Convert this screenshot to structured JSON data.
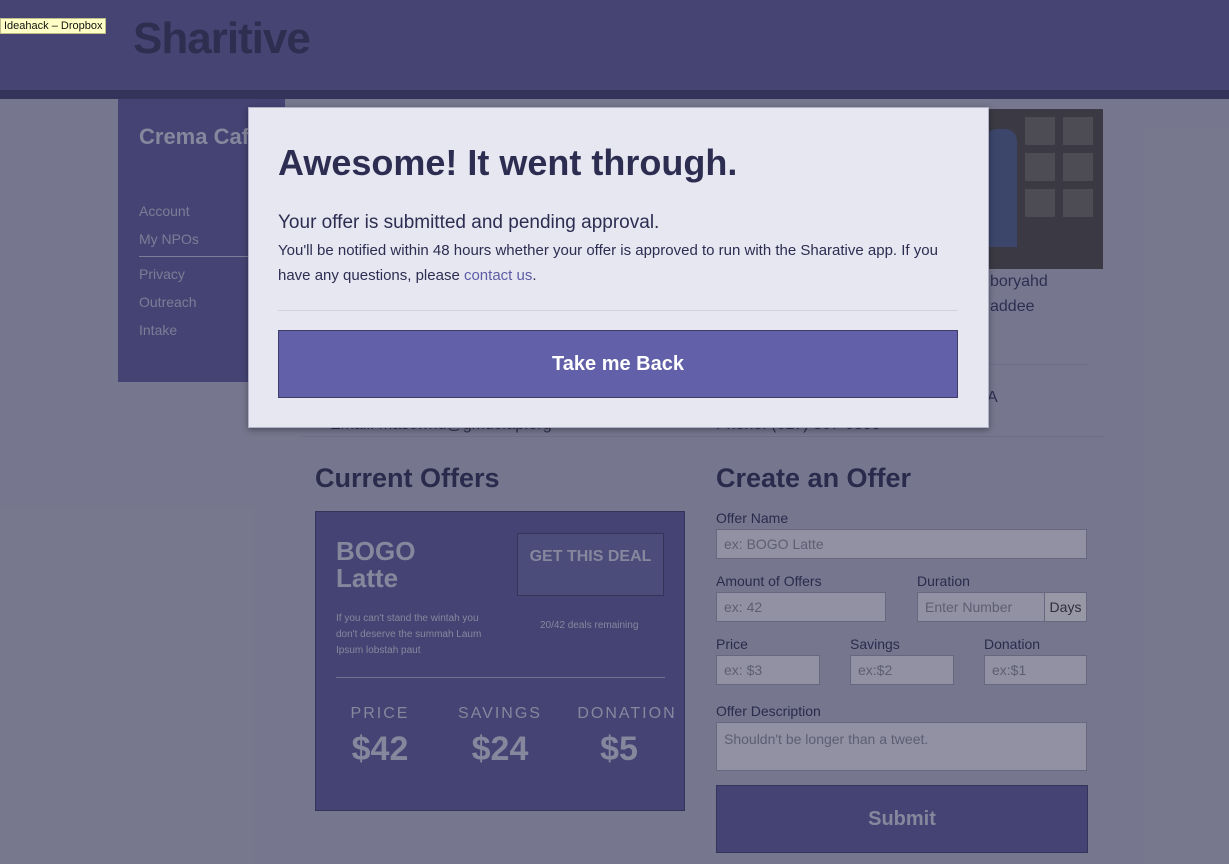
{
  "tooltip": "Ideahack – Dropbox",
  "header": {
    "brand": "Sharitive"
  },
  "sidebar": {
    "business_name": "Crema Cafe",
    "items": [
      "Account",
      "My NPOs",
      "Privacy",
      "Outreach",
      "Intake"
    ]
  },
  "profile_fragments": {
    "name_1": "boryahd",
    "name_2": "addee",
    "location_end": "A",
    "email_fragment": "Email: mascwnd@gmuc.ap.org",
    "phone_fragment": "Phone: (617) 367-0300"
  },
  "current_offers": {
    "title": "Current Offers",
    "offer": {
      "name": "BOGO Latte",
      "cta": "GET THIS DEAL",
      "description": "If you can't stand the wintah you don't deserve the summah Laum Ipsum lobstah paut",
      "remaining": "20/42 deals remaining",
      "stats": [
        {
          "label": "PRICE",
          "value": "$42"
        },
        {
          "label": "SAVINGS",
          "value": "$24"
        },
        {
          "label": "DONATION",
          "value": "$5"
        }
      ]
    }
  },
  "create_offer": {
    "title": "Create an Offer",
    "offer_name": {
      "label": "Offer Name",
      "placeholder": "ex: BOGO Latte"
    },
    "amount": {
      "label": "Amount of Offers",
      "placeholder": "ex: 42"
    },
    "duration": {
      "label": "Duration",
      "placeholder": "Enter Number",
      "unit": "Days"
    },
    "price": {
      "label": "Price",
      "placeholder": "ex: $3"
    },
    "savings": {
      "label": "Savings",
      "placeholder": "ex:$2"
    },
    "donation": {
      "label": "Donation",
      "placeholder": "ex:$1"
    },
    "description": {
      "label": "Offer Description",
      "placeholder": "Shouldn't be longer than a tweet."
    },
    "submit": "Submit"
  },
  "modal": {
    "title": "Awesome! It went through.",
    "subtitle": "Your offer is submitted and pending approval.",
    "body_pre": "You'll be notified within 48 hours whether your offer is approved to run with the Sharative app. If you have any questions, please ",
    "body_link": "contact us",
    "body_post": ".",
    "back_button": "Take me Back"
  }
}
